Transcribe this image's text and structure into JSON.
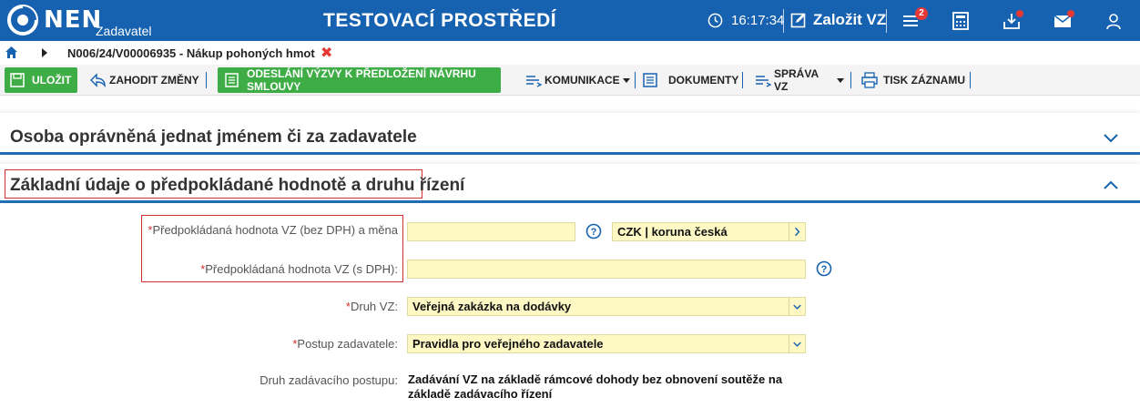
{
  "header": {
    "logo_text": "NEN",
    "logo_sub": "Zadavatel",
    "env_title": "TESTOVACÍ PROSTŘEDÍ",
    "time": "16:17:34",
    "new_vz": "Založit VZ",
    "notif_count": "2",
    "brand_color": "#1662b1"
  },
  "breadcrumb": {
    "path": "N006/24/V00006935 - Nákup pohoných hmot",
    "close": "✖"
  },
  "toolbar": {
    "save": "ULOŽIT",
    "discard": "ZAHODIT ZMĚNY",
    "send": "ODESLÁNÍ VÝZVY K PŘEDLOŽENÍ NÁVRHU SMLOUVY",
    "comm": "KOMUNIKACE",
    "docs": "DOKUMENTY",
    "admin": "SPRÁVA VZ",
    "print": "TISK ZÁZNAMU"
  },
  "sections": {
    "person_title": "Osoba oprávněná jednat jménem či za zadavatele",
    "basic_title": "Základní údaje o předpokládané hodnotě a druhu řízení"
  },
  "form": {
    "value_no_vat_label": "Předpokládaná hodnota VZ (bez DPH) a měna",
    "value_no_vat": "",
    "currency": "CZK | koruna česká",
    "value_vat_label": "Předpokládaná hodnota VZ (s DPH):",
    "value_vat": "",
    "kind_label": "Druh VZ:",
    "kind_value": "Veřejná zakázka na dodávky",
    "procedure_label": "Postup zadavatele:",
    "procedure_value": "Pravidla pro veřejného zadavatele",
    "proc_type_label": "Druh zadávacího postupu:",
    "proc_type_value": "Zadávání VZ na základě rámcové dohody bez obnovení soutěže na základě zadávacího řízení",
    "required_mark": "*"
  }
}
